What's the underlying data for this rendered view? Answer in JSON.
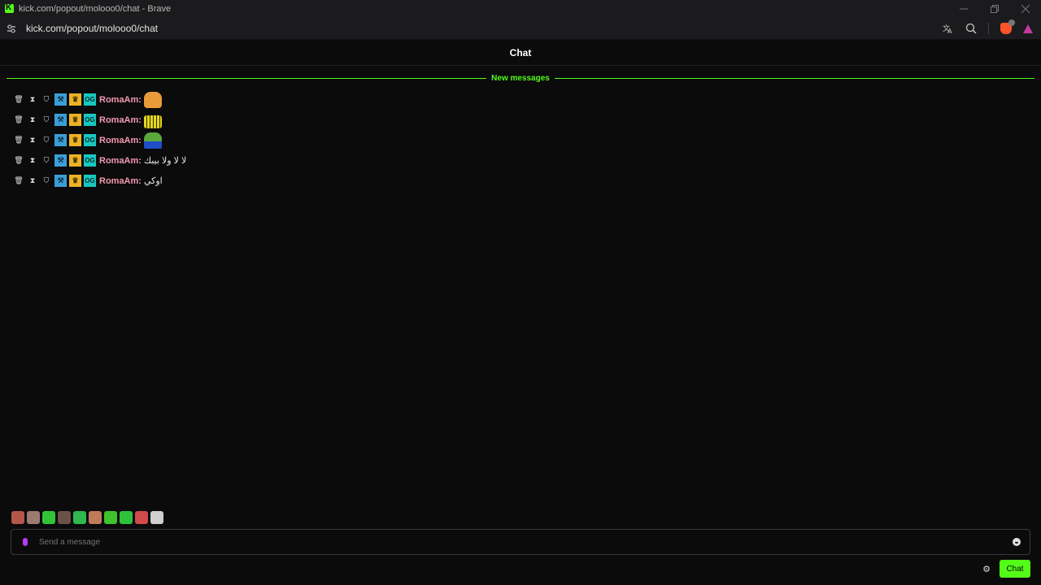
{
  "browser": {
    "window_title": "kick.com/popout/molooo0/chat - Brave",
    "url": "kick.com/popout/molooo0/chat",
    "icons": [
      "translate-icon",
      "zoom-icon",
      "brave-shields-icon",
      "brave-rewards-icon"
    ]
  },
  "chat": {
    "title": "Chat",
    "new_messages_label": "New messages",
    "messages": [
      {
        "username": "RomaAm:",
        "text": "",
        "emote": "cat-emote"
      },
      {
        "username": "RomaAm:",
        "text": "",
        "emote": "equalizer-emote"
      },
      {
        "username": "RomaAm:",
        "text": "",
        "emote": "frog-emote"
      },
      {
        "username": "RomaAm:",
        "text": "لا لا ولا بيبك"
      },
      {
        "username": "RomaAm:",
        "text": "اوكي"
      }
    ],
    "badges": {
      "mod": "mod-badge",
      "crown": "crown-badge",
      "og": "og-badge"
    },
    "og_badge_text": "OG"
  },
  "emote_bar": {
    "emotes": [
      {
        "name": "emote-1",
        "color": "#b4574a"
      },
      {
        "name": "emote-2",
        "color": "#9b7a70"
      },
      {
        "name": "emote-3",
        "color": "#31c437"
      },
      {
        "name": "emote-4",
        "color": "#6a5246"
      },
      {
        "name": "emote-5",
        "color": "#2eb84e"
      },
      {
        "name": "emote-6",
        "color": "#c27a5c"
      },
      {
        "name": "emote-7",
        "color": "#3ec22e"
      },
      {
        "name": "emote-8",
        "color": "#2ec23a"
      },
      {
        "name": "emote-9",
        "color": "#d04a4a"
      },
      {
        "name": "emote-10",
        "color": "#cfcfcf"
      }
    ]
  },
  "input": {
    "placeholder": "Send a message"
  },
  "send_button_label": "Chat",
  "colors": {
    "accent": "#53fc18",
    "username": "#f29ab0",
    "background": "#0b0b0c"
  }
}
